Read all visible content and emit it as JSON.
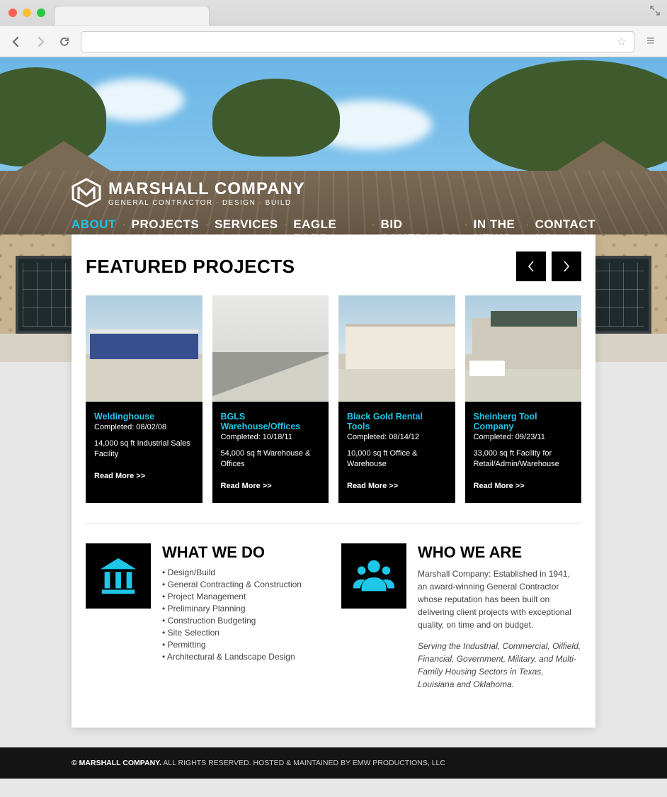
{
  "url": "",
  "logo": {
    "company": "MARSHALL COMPANY",
    "tagline": "GENERAL CONTRACTOR · DESIGN · BUILD"
  },
  "nav": [
    {
      "label": "ABOUT US",
      "active": true
    },
    {
      "label": "PROJECTS"
    },
    {
      "label": "SERVICES"
    },
    {
      "label": "EAGLE FORD SHALE"
    },
    {
      "label": "BID SCHEDULES"
    },
    {
      "label": "IN THE NEWS"
    },
    {
      "label": "CONTACT US"
    }
  ],
  "featured": {
    "heading": "FEATURED PROJECTS",
    "read_more": "Read More >>",
    "items": [
      {
        "title": "Weldinghouse",
        "date": "Completed: 08/02/08",
        "desc": "14,000 sq ft Industrial Sales Facility"
      },
      {
        "title": "BGLS Warehouse/Offices",
        "date": "Completed: 10/18/11",
        "desc": "54,000 sq ft Warehouse & Offices"
      },
      {
        "title": "Black Gold Rental Tools",
        "date": "Completed: 08/14/12",
        "desc": "10,000 sq ft Office & Warehouse"
      },
      {
        "title": "Sheinberg Tool Company",
        "date": "Completed: 09/23/11",
        "desc": "33,000 sq ft Facility for Retail/Admin/Warehouse"
      }
    ]
  },
  "what": {
    "heading": "WHAT WE DO",
    "items": [
      "Design/Build",
      "General Contracting & Construction",
      "Project Management",
      "Preliminary Planning",
      "Construction Budgeting",
      "Site Selection",
      "Permitting",
      "Architectural & Landscape Design"
    ]
  },
  "who": {
    "heading": "WHO WE ARE",
    "p1": "Marshall Company: Established in 1941, an award-winning General Contractor whose reputation has been built on delivering client projects with exceptional quality, on time and on budget.",
    "p2": "Serving the Industrial, Commercial, Oilfield, Financial, Government, Military, and Multi-Family Housing Sectors in Texas, Louisiana and Oklahoma."
  },
  "footer": {
    "brand": "© MARSHALL COMPANY.",
    "rest": " ALL RIGHTS RESERVED. HOSTED & MAINTAINED BY EMW PRODUCTIONS, LLC"
  }
}
